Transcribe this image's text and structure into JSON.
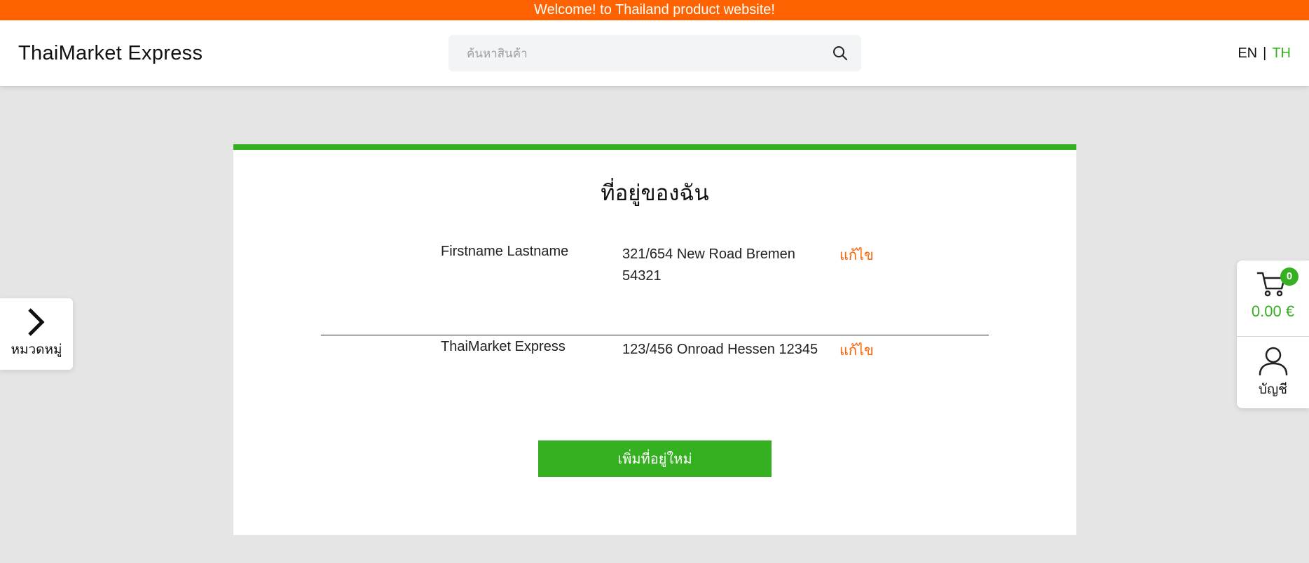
{
  "announcement": "Welcome! to Thailand product website!",
  "header": {
    "brand": "ThaiMarket Express",
    "search_placeholder": "ค้นหาสินค้า",
    "lang_en": "EN",
    "lang_sep": "|",
    "lang_th": "TH"
  },
  "main": {
    "title": "ที่อยู่ของฉัน",
    "addresses": [
      {
        "name": "Firstname Lastname",
        "address": "321/654 New Road Bremen 54321",
        "edit": "แก้ไข"
      },
      {
        "name": "ThaiMarket Express",
        "address": "123/456 Onroad Hessen 12345",
        "edit": "แก้ไข"
      }
    ],
    "add_button": "เพิ่มที่อยู่ใหม่"
  },
  "sidebar_left": {
    "categories_label": "หมวดหมู่"
  },
  "sidebar_right": {
    "cart_count": "0",
    "cart_total": "0.00 €",
    "account_label": "บัญชี"
  },
  "colors": {
    "accent_orange": "#ff6200",
    "accent_green": "#35b020",
    "background": "#e5e5e5"
  },
  "icons": {
    "search": "search-icon",
    "cart": "cart-icon",
    "account": "user-icon",
    "categories": "chevron-right-icon"
  }
}
